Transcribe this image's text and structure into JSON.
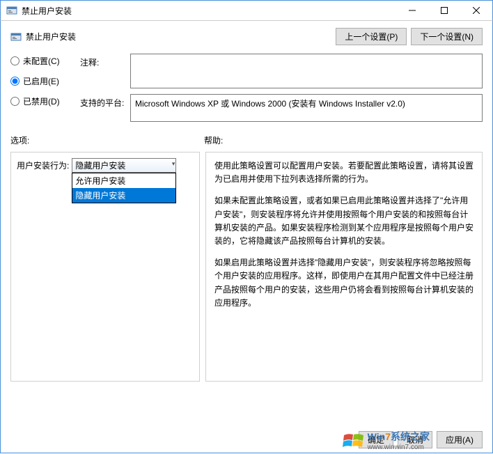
{
  "window": {
    "title": "禁止用户安装"
  },
  "header": {
    "title": "禁止用户安装",
    "prev_button": "上一个设置(P)",
    "next_button": "下一个设置(N)"
  },
  "radios": {
    "not_configured": "未配置(C)",
    "enabled": "已启用(E)",
    "disabled": "已禁用(D)",
    "selected": "enabled"
  },
  "fields": {
    "comment_label": "注释:",
    "comment_value": "",
    "platform_label": "支持的平台:",
    "platform_value": "Microsoft Windows XP 或 Windows 2000 (安装有 Windows Installer v2.0)"
  },
  "sections": {
    "options_label": "选项:",
    "help_label": "帮助:"
  },
  "options": {
    "behavior_label": "用户安装行为:",
    "selected_value": "隐藏用户安装",
    "dropdown": [
      "允许用户安装",
      "隐藏用户安装"
    ]
  },
  "help": {
    "p1": "使用此策略设置可以配置用户安装。若要配置此策略设置，请将其设置为已启用并使用下拉列表选择所需的行为。",
    "p2": "如果未配置此策略设置，或者如果已启用此策略设置并选择了\"允许用户安装\"，则安装程序将允许并使用按照每个用户安装的和按照每台计算机安装的产品。如果安装程序检测到某个应用程序是按照每个用户安装的，它将隐藏该产品按照每台计算机的安装。",
    "p3": "如果启用此策略设置并选择\"隐藏用户安装\"，则安装程序将忽略按照每个用户安装的应用程序。这样，即使用户在其用户配置文件中已经注册产品按照每个用户的安装，这些用户仍将会看到按照每台计算机安装的应用程序。"
  },
  "footer": {
    "ok": "确定",
    "cancel": "取消",
    "apply": "应用(A)"
  },
  "watermark": {
    "brand_prefix": "Win",
    "brand_seven": "7",
    "brand_suffix": "系统之家",
    "url": "www.winwin7.com"
  }
}
